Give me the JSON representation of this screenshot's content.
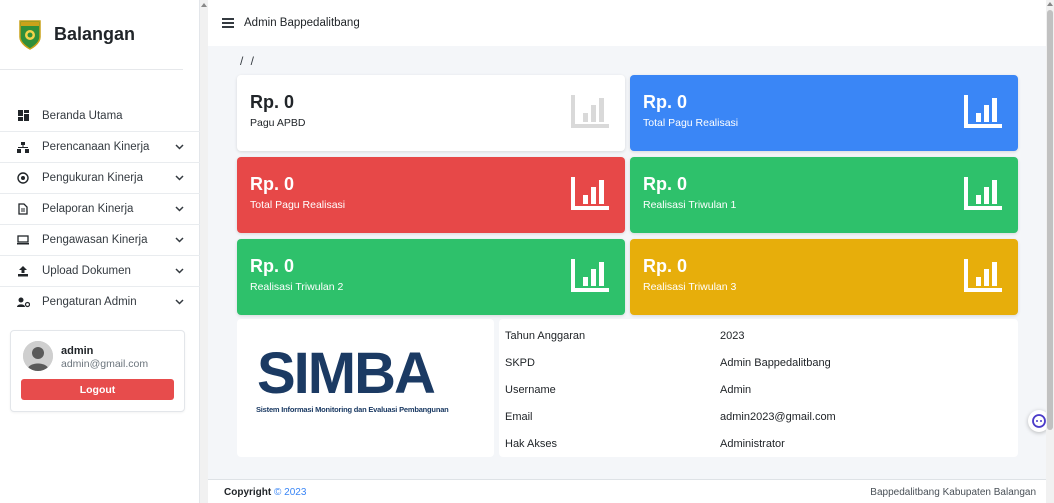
{
  "sidebar": {
    "brand_name": "Balangan",
    "items": [
      {
        "label": "Beranda Utama",
        "icon": "dashboard-icon",
        "has_children": false
      },
      {
        "label": "Perencanaan Kinerja",
        "icon": "sitemap-icon",
        "has_children": true
      },
      {
        "label": "Pengukuran Kinerja",
        "icon": "target-icon",
        "has_children": true
      },
      {
        "label": "Pelaporan Kinerja",
        "icon": "file-icon",
        "has_children": true
      },
      {
        "label": "Pengawasan Kinerja",
        "icon": "monitor-icon",
        "has_children": true
      },
      {
        "label": "Upload Dokumen",
        "icon": "upload-icon",
        "has_children": true
      },
      {
        "label": "Pengaturan Admin",
        "icon": "users-cog-icon",
        "has_children": true
      }
    ],
    "user": {
      "name": "admin",
      "email": "admin@gmail.com",
      "logout_label": "Logout"
    }
  },
  "header": {
    "title": "Admin Bappedalitbang"
  },
  "breadcrumb": "/ /",
  "cards": [
    {
      "amount": "Rp. 0",
      "label": "Pagu APBD",
      "color": "#ffffff"
    },
    {
      "amount": "Rp. 0",
      "label": "Total Pagu Realisasi",
      "color": "#3a86f6"
    },
    {
      "amount": "Rp. 0",
      "label": "Total Pagu Realisasi",
      "color": "#e74848"
    },
    {
      "amount": "Rp. 0",
      "label": "Realisasi Triwulan 1",
      "color": "#2ec16b"
    },
    {
      "amount": "Rp. 0",
      "label": "Realisasi Triwulan 2",
      "color": "#2ec16b"
    },
    {
      "amount": "Rp. 0",
      "label": "Realisasi Triwulan 3",
      "color": "#e7ae0b"
    }
  ],
  "logo": {
    "word": "SIMBA",
    "subtitle": "Sistem Informasi Monitoring dan Evaluasi Pembangunan"
  },
  "info": [
    {
      "key": "Tahun Anggaran",
      "value": "2023"
    },
    {
      "key": "SKPD",
      "value": "Admin Bappedalitbang"
    },
    {
      "key": "Username",
      "value": "Admin"
    },
    {
      "key": "Email",
      "value": "admin2023@gmail.com"
    },
    {
      "key": "Hak Akses",
      "value": "Administrator"
    }
  ],
  "footer": {
    "copyright_label": "Copyright",
    "copyright_year": "© 2023",
    "org": "Bappedalitbang Kabupaten Balangan"
  },
  "colors": {
    "primary": "#3a86f6",
    "danger": "#e74848",
    "success": "#2ec16b",
    "warning": "#e7ae0b",
    "logo_navy": "#1b3a63"
  }
}
